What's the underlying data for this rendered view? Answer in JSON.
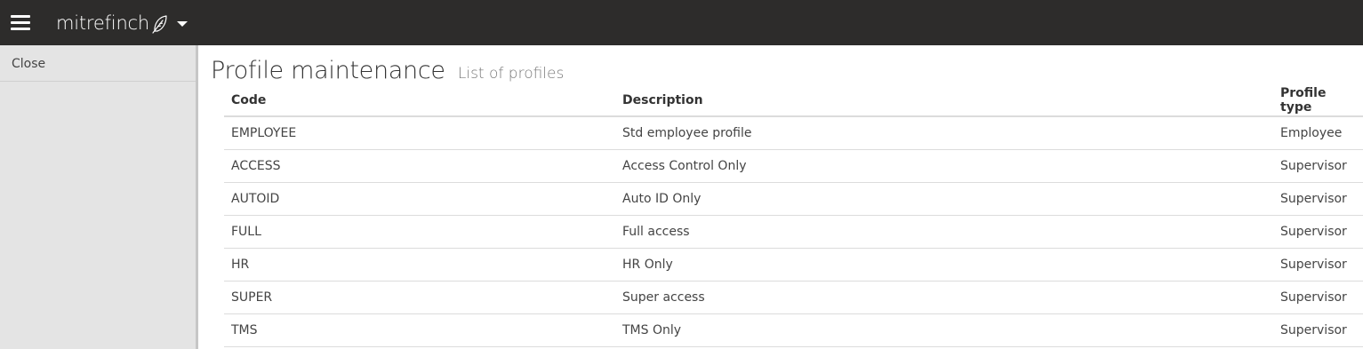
{
  "header": {
    "brand": "mitrefinch",
    "menu_icon": "hamburger-menu-icon",
    "brand_icon": "feather-icon",
    "dropdown_icon": "caret-down-icon",
    "background_color": "#2d2c2b"
  },
  "sidebar": {
    "items": [
      {
        "label": "Close"
      }
    ],
    "background_color": "#e4e4e4"
  },
  "main": {
    "title": "Profile maintenance",
    "subtitle": "List of profiles"
  },
  "table": {
    "columns": [
      "Code",
      "Description",
      "Profile type"
    ],
    "rows": [
      {
        "code": "EMPLOYEE",
        "description": "Std employee profile",
        "type": "Employee"
      },
      {
        "code": "ACCESS",
        "description": "Access Control Only",
        "type": "Supervisor"
      },
      {
        "code": "AUTOID",
        "description": "Auto ID Only",
        "type": "Supervisor"
      },
      {
        "code": "FULL",
        "description": "Full access",
        "type": "Supervisor"
      },
      {
        "code": "HR",
        "description": "HR Only",
        "type": "Supervisor"
      },
      {
        "code": "SUPER",
        "description": "Super access",
        "type": "Supervisor"
      },
      {
        "code": "TMS",
        "description": "TMS Only",
        "type": "Supervisor"
      }
    ]
  }
}
